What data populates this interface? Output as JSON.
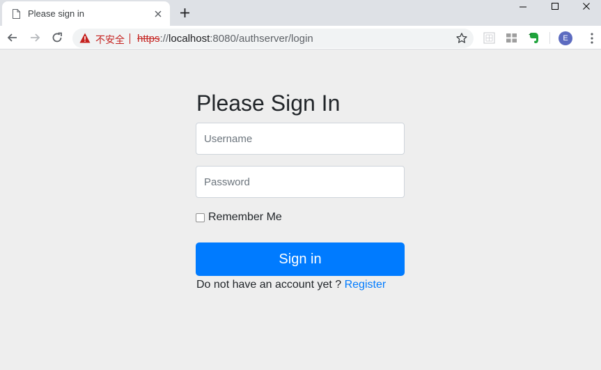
{
  "browser": {
    "tab": {
      "title": "Please sign in"
    },
    "omnibox": {
      "security_text": "不安全",
      "url_scheme": "https",
      "url_sep": "://",
      "url_host": "localhost",
      "url_rest": ":8080/authserver/login"
    },
    "profile": {
      "initial": "E",
      "color": "#5c6bc0"
    }
  },
  "form": {
    "heading": "Please Sign In",
    "username_placeholder": "Username",
    "password_placeholder": "Password",
    "remember_label": "Remember Me",
    "remember_checked": false,
    "submit_label": "Sign in",
    "register_prompt": "Do not have an account yet ?",
    "register_link": "Register"
  },
  "colors": {
    "primary": "#007bff",
    "insecure": "#c5221f",
    "page_bg": "#eeeeee"
  }
}
